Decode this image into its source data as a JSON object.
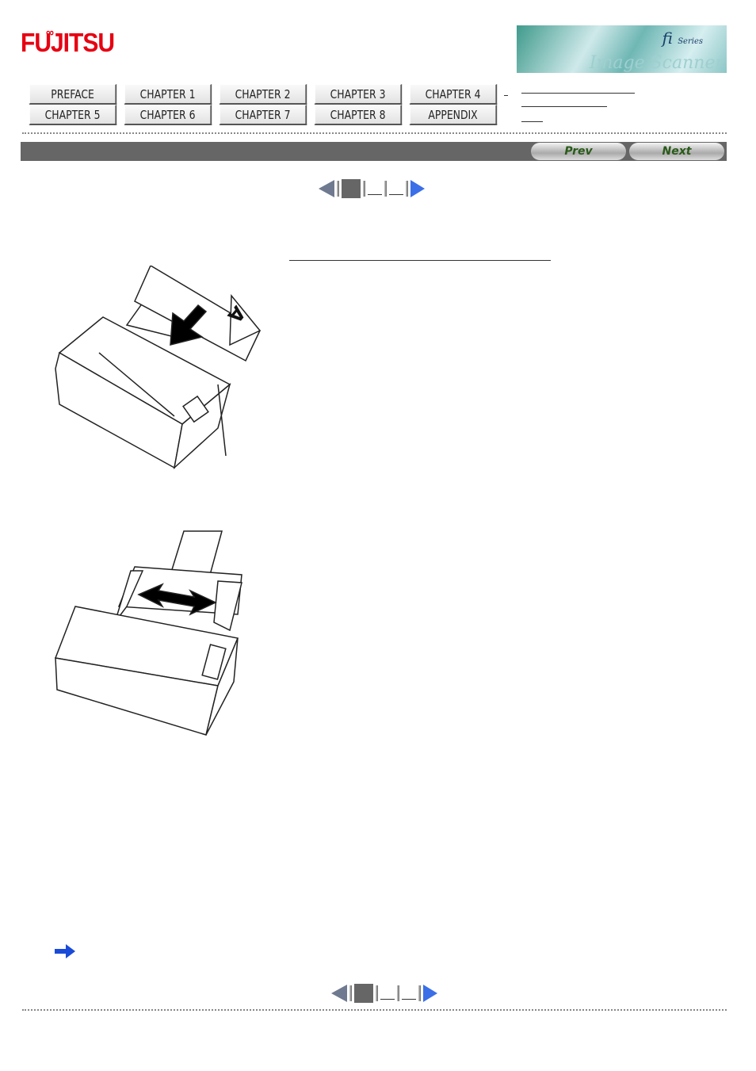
{
  "header": {
    "logo_text": "FUJITSU",
    "banner_text": "fi Series Image Scanner"
  },
  "nav": {
    "items": [
      "PREFACE",
      "CHAPTER 1",
      "CHAPTER 2",
      "CHAPTER 3",
      "CHAPTER 4",
      "CHAPTER 5",
      "CHAPTER 6",
      "CHAPTER 7",
      "CHAPTER 8",
      "APPENDIX"
    ]
  },
  "toolbar": {
    "prev_label": "Prev",
    "next_label": "Next"
  },
  "colors": {
    "title_bar": "#666666",
    "accent_blue": "#3b6fe8",
    "logo_red": "#e60012"
  },
  "icons": {
    "pager_prev": "triangle-left-icon",
    "pager_next": "triangle-right-icon",
    "note": "arrow-right-icon"
  }
}
